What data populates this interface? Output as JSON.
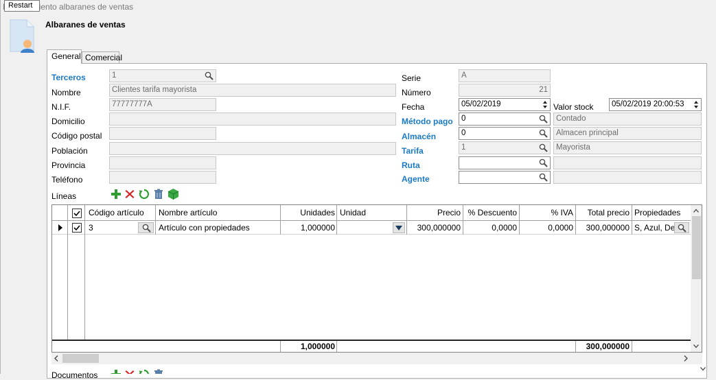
{
  "tooltip": "Restart",
  "window_title": "Mantenimiento albaranes de ventas",
  "header_title": "Albaranes de ventas",
  "tabs": [
    {
      "label": "General",
      "active": true
    },
    {
      "label": "Comercial",
      "active": false
    }
  ],
  "left": {
    "terceros": {
      "label": "Terceros",
      "value": "1"
    },
    "nombre": {
      "label": "Nombre",
      "value": "Clientes tarifa mayorista"
    },
    "nif": {
      "label": "N.I.F.",
      "value": "77777777A"
    },
    "domicilio": {
      "label": "Domicilio",
      "value": ""
    },
    "codigo_postal": {
      "label": "Código postal",
      "value": ""
    },
    "poblacion": {
      "label": "Población",
      "value": ""
    },
    "provincia": {
      "label": "Provincia",
      "value": ""
    },
    "telefono": {
      "label": "Teléfono",
      "value": ""
    }
  },
  "right": {
    "serie": {
      "label": "Serie",
      "value": "A"
    },
    "numero": {
      "label": "Número",
      "value": "21"
    },
    "fecha": {
      "label": "Fecha",
      "value": "05/02/2019"
    },
    "valor_stock": {
      "label": "Valor stock",
      "value": "05/02/2019 20:00:53"
    },
    "metodo_pago": {
      "label": "Método pago",
      "value": "0",
      "desc": "Contado"
    },
    "almacen": {
      "label": "Almacén",
      "value": "0",
      "desc": "Almacen principal"
    },
    "tarifa": {
      "label": "Tarifa",
      "value": "1",
      "desc": "Mayorista"
    },
    "ruta": {
      "label": "Ruta",
      "value": "",
      "desc": ""
    },
    "agente": {
      "label": "Agente",
      "value": "",
      "desc": ""
    }
  },
  "lineas_label": "Líneas",
  "bottom_label": "Documentos",
  "grid": {
    "columns": [
      "Código artículo",
      "Nombre artículo",
      "Unidades",
      "Unidad",
      "Precio",
      "% Descuento",
      "% IVA",
      "Total precio",
      "Propiedades"
    ],
    "rows": [
      {
        "codigo": "3",
        "nombre": "Artículo con propiedades",
        "unidades": "1,000000",
        "unidad": "",
        "precio": "300,000000",
        "descuento": "0,0000",
        "iva": "0,0000",
        "total": "300,000000",
        "propiedades": "S, Azul, De",
        "checked": true
      }
    ],
    "totals": {
      "unidades": "1,000000",
      "total": "300,000000"
    }
  },
  "colors": {
    "accent": "#1a7ac4",
    "add": "#2f9e2f",
    "delete": "#d62222",
    "refresh": "#2f9e2f",
    "trash": "#5a7fa8",
    "cube": "#3aa845"
  }
}
